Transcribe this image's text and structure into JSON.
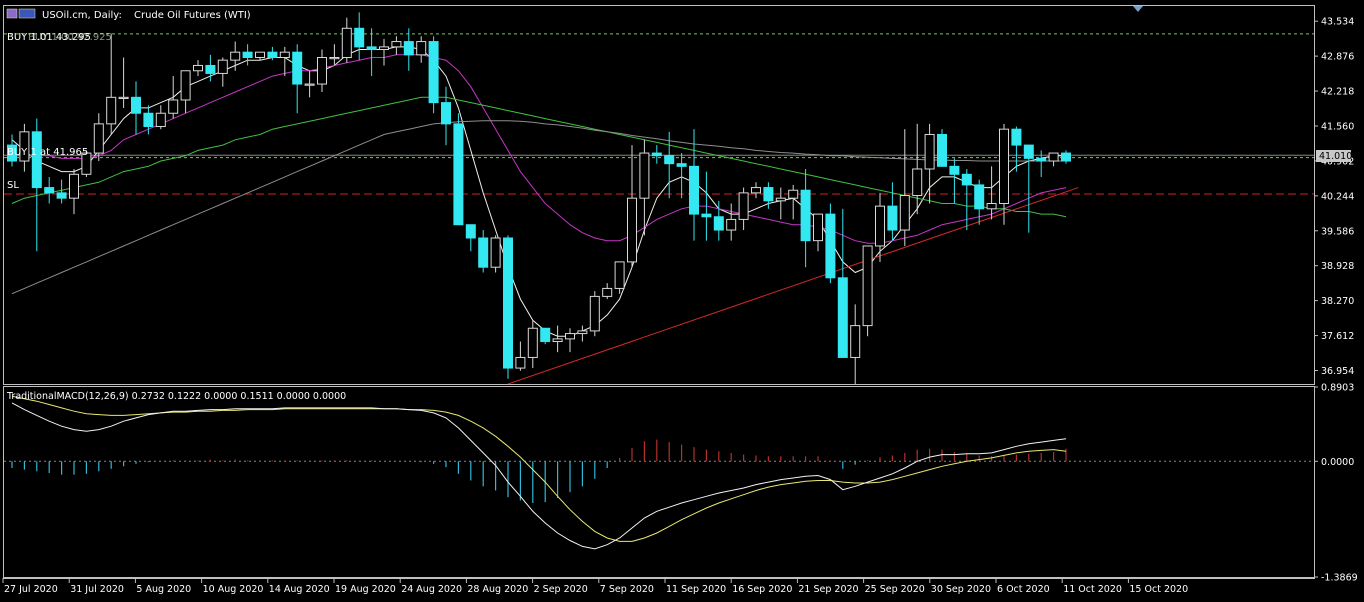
{
  "header": {
    "symbol_label": "USOil.cm, Daily:",
    "instrument_name": "Crude Oil Futures (WTI)"
  },
  "trade_lines": {
    "buy_top": "BUY 1.01 43.295",
    "buy_top_overlap": "BUY 1.00 42.925",
    "buy_mid": "BUY 1 at 41.965",
    "sl": "SL"
  },
  "colors": {
    "background": "#000000",
    "axis": "#c0c0c0",
    "text": "#ffffff",
    "bull": "#000000",
    "bull_border": "#2a2a2a",
    "bear": "#33e8f0",
    "buy_line": "#6fcf4a",
    "sl_line": "#d0222a",
    "price_tag_bg": "#c8c8c8",
    "ma_white": "#f2f2e8",
    "ma_magenta": "#c735c7",
    "ma_green": "#3fc23f",
    "ma_gray": "#8e8e8e",
    "trend_red": "#d12a2a",
    "macd_line": "#e8e870",
    "signal_line": "#f2f2f2",
    "hist_pos": "#b5302a",
    "hist_neg": "#2fb8d8"
  },
  "chart_data": [
    {
      "type": "candlestick",
      "y_ticks": [
        "43.534",
        "42.876",
        "42.218",
        "41.560",
        "40.902",
        "40.244",
        "39.586",
        "38.928",
        "38.270",
        "37.612",
        "36.954"
      ],
      "ylim": [
        36.7,
        43.82
      ],
      "current_price": "41.010",
      "levels": {
        "buy_top": 43.295,
        "buy_mid": 40.965,
        "sl": 40.28
      },
      "x_labels": [
        "27 Jul 2020",
        "31 Jul 2020",
        "5 Aug 2020",
        "10 Aug 2020",
        "14 Aug 2020",
        "19 Aug 2020",
        "24 Aug 2020",
        "28 Aug 2020",
        "2 Sep 2020",
        "7 Sep 2020",
        "11 Sep 2020",
        "16 Sep 2020",
        "21 Sep 2020",
        "25 Sep 2020",
        "30 Sep 2020",
        "6 Oct 2020",
        "11 Oct 2020",
        "15 Oct 2020"
      ],
      "ohlc": [
        [
          41.2,
          41.4,
          40.8,
          40.9
        ],
        [
          40.9,
          41.6,
          40.7,
          41.45
        ],
        [
          41.45,
          41.7,
          39.2,
          40.4
        ],
        [
          40.4,
          40.6,
          40.1,
          40.3
        ],
        [
          40.3,
          40.55,
          40.1,
          40.2
        ],
        [
          40.2,
          40.75,
          39.9,
          40.65
        ],
        [
          40.65,
          41.1,
          40.6,
          41.05
        ],
        [
          41.05,
          41.8,
          40.9,
          41.6
        ],
        [
          41.6,
          43.3,
          41.4,
          42.1
        ],
        [
          42.1,
          42.85,
          41.9,
          42.1
        ],
        [
          42.1,
          42.4,
          41.4,
          41.8
        ],
        [
          41.8,
          41.95,
          41.4,
          41.55
        ],
        [
          41.55,
          41.95,
          41.5,
          41.8
        ],
        [
          41.8,
          42.5,
          41.7,
          42.05
        ],
        [
          42.05,
          42.6,
          41.8,
          42.6
        ],
        [
          42.6,
          42.8,
          42.5,
          42.7
        ],
        [
          42.7,
          42.9,
          42.4,
          42.55
        ],
        [
          42.55,
          42.85,
          42.3,
          42.8
        ],
        [
          42.8,
          43.15,
          42.6,
          42.95
        ],
        [
          42.95,
          43.1,
          42.7,
          42.85
        ],
        [
          42.85,
          42.95,
          42.8,
          42.95
        ],
        [
          42.95,
          43.05,
          42.8,
          42.85
        ],
        [
          42.85,
          43.05,
          42.5,
          42.95
        ],
        [
          42.95,
          43.1,
          41.8,
          42.35
        ],
        [
          42.35,
          42.6,
          42.1,
          42.35
        ],
        [
          42.35,
          43.0,
          42.2,
          42.85
        ],
        [
          42.85,
          43.1,
          42.7,
          42.85
        ],
        [
          42.85,
          43.6,
          42.75,
          43.4
        ],
        [
          43.4,
          43.7,
          42.8,
          43.05
        ],
        [
          43.05,
          43.4,
          42.5,
          43.0
        ],
        [
          43.0,
          43.2,
          42.7,
          43.05
        ],
        [
          43.05,
          43.25,
          42.9,
          43.15
        ],
        [
          43.15,
          43.4,
          42.6,
          42.9
        ],
        [
          42.9,
          43.25,
          42.75,
          43.15
        ],
        [
          43.15,
          43.25,
          41.8,
          42.0
        ],
        [
          42.0,
          42.3,
          41.2,
          41.6
        ],
        [
          41.6,
          41.8,
          39.8,
          39.7
        ],
        [
          39.7,
          39.6,
          39.2,
          39.45
        ],
        [
          39.45,
          39.6,
          38.8,
          38.9
        ],
        [
          38.9,
          39.5,
          38.8,
          39.45
        ],
        [
          39.45,
          39.5,
          36.8,
          37.0
        ],
        [
          37.0,
          37.5,
          36.95,
          37.2
        ],
        [
          37.2,
          37.9,
          37.0,
          37.75
        ],
        [
          37.75,
          37.6,
          37.45,
          37.5
        ],
        [
          37.5,
          37.8,
          37.3,
          37.55
        ],
        [
          37.55,
          37.75,
          37.3,
          37.65
        ],
        [
          37.65,
          37.8,
          37.5,
          37.7
        ],
        [
          37.7,
          38.45,
          37.6,
          38.35
        ],
        [
          38.35,
          38.6,
          38.3,
          38.5
        ],
        [
          38.5,
          39.0,
          38.4,
          39.0
        ],
        [
          39.0,
          41.2,
          38.9,
          40.2
        ],
        [
          40.2,
          41.3,
          39.5,
          41.05
        ],
        [
          41.05,
          41.2,
          40.85,
          41.0
        ],
        [
          41.0,
          41.45,
          40.2,
          40.85
        ],
        [
          40.85,
          41.05,
          40.2,
          40.8
        ],
        [
          40.8,
          41.5,
          39.4,
          39.9
        ],
        [
          39.9,
          40.7,
          39.4,
          39.85
        ],
        [
          39.85,
          40.15,
          39.4,
          39.6
        ],
        [
          39.6,
          40.1,
          39.4,
          39.8
        ],
        [
          39.8,
          40.4,
          39.6,
          40.3
        ],
        [
          40.3,
          40.5,
          40.2,
          40.4
        ],
        [
          40.4,
          40.5,
          40.0,
          40.15
        ],
        [
          40.15,
          40.4,
          39.8,
          40.2
        ],
        [
          40.2,
          40.45,
          39.8,
          40.35
        ],
        [
          40.35,
          40.75,
          38.9,
          39.4
        ],
        [
          39.4,
          39.9,
          39.2,
          39.9
        ],
        [
          39.9,
          40.1,
          38.6,
          38.7
        ],
        [
          38.7,
          40.0,
          37.8,
          37.2
        ],
        [
          37.2,
          38.2,
          36.7,
          37.8
        ],
        [
          37.8,
          39.1,
          37.6,
          39.3
        ],
        [
          39.3,
          40.3,
          39.0,
          40.05
        ],
        [
          40.05,
          40.5,
          39.4,
          39.6
        ],
        [
          39.6,
          41.5,
          39.3,
          40.25
        ],
        [
          40.25,
          41.6,
          39.9,
          40.75
        ],
        [
          40.75,
          41.6,
          40.1,
          41.4
        ],
        [
          41.4,
          41.5,
          40.8,
          40.8
        ],
        [
          40.8,
          40.95,
          40.1,
          40.65
        ],
        [
          40.65,
          40.75,
          39.6,
          40.45
        ],
        [
          40.45,
          40.55,
          39.7,
          40.0
        ],
        [
          40.0,
          40.8,
          39.8,
          40.1
        ],
        [
          40.1,
          41.6,
          39.7,
          41.5
        ],
        [
          41.5,
          41.55,
          40.7,
          41.2
        ],
        [
          41.2,
          41.2,
          39.55,
          40.95
        ],
        [
          40.95,
          41.1,
          40.6,
          40.9
        ],
        [
          40.9,
          41.05,
          40.8,
          41.05
        ],
        [
          41.05,
          41.1,
          40.85,
          40.9
        ]
      ],
      "series": [
        {
          "name": "",
          "color_key": "ma_white",
          "values": [
            41.3,
            41.1,
            40.9,
            40.8,
            40.7,
            40.7,
            40.8,
            41.1,
            41.4,
            41.7,
            41.9,
            41.9,
            42.0,
            42.1,
            42.3,
            42.4,
            42.5,
            42.6,
            42.7,
            42.8,
            42.8,
            42.85,
            42.85,
            42.7,
            42.6,
            42.6,
            42.7,
            42.9,
            43.0,
            43.0,
            43.0,
            43.05,
            43.05,
            43.0,
            42.8,
            42.5,
            41.9,
            41.1,
            40.3,
            39.6,
            38.9,
            38.3,
            37.9,
            37.7,
            37.6,
            37.6,
            37.7,
            37.8,
            38.0,
            38.3,
            38.9,
            39.6,
            40.2,
            40.5,
            40.6,
            40.5,
            40.3,
            40.0,
            39.9,
            39.9,
            40.0,
            40.1,
            40.15,
            40.2,
            40.0,
            39.8,
            39.4,
            39.0,
            38.8,
            38.9,
            39.2,
            39.4,
            39.7,
            40.0,
            40.4,
            40.6,
            40.6,
            40.5,
            40.4,
            40.4,
            40.6,
            40.8,
            40.9,
            40.95,
            41.0,
            41.0
          ]
        },
        {
          "name": "",
          "color_key": "ma_magenta",
          "values": [
            41.0,
            41.0,
            41.0,
            41.0,
            40.95,
            40.95,
            40.95,
            41.0,
            41.1,
            41.3,
            41.4,
            41.5,
            41.6,
            41.7,
            41.8,
            41.9,
            42.0,
            42.1,
            42.2,
            42.3,
            42.4,
            42.5,
            42.55,
            42.6,
            42.6,
            42.65,
            42.7,
            42.75,
            42.8,
            42.85,
            42.85,
            42.9,
            42.9,
            42.9,
            42.85,
            42.8,
            42.6,
            42.3,
            41.9,
            41.5,
            41.1,
            40.7,
            40.4,
            40.1,
            39.9,
            39.7,
            39.55,
            39.45,
            39.4,
            39.4,
            39.5,
            39.65,
            39.8,
            39.9,
            40.0,
            40.05,
            40.05,
            40.0,
            39.95,
            39.9,
            39.85,
            39.8,
            39.75,
            39.7,
            39.7,
            39.65,
            39.6,
            39.5,
            39.4,
            39.35,
            39.35,
            39.4,
            39.45,
            39.5,
            39.6,
            39.7,
            39.75,
            39.8,
            39.85,
            39.9,
            40.0,
            40.1,
            40.2,
            40.3,
            40.35,
            40.4
          ]
        },
        {
          "name": "",
          "color_key": "ma_green",
          "values": [
            40.1,
            40.2,
            40.25,
            40.3,
            40.35,
            40.4,
            40.45,
            40.5,
            40.6,
            40.7,
            40.75,
            40.8,
            40.9,
            40.95,
            41.0,
            41.1,
            41.15,
            41.2,
            41.3,
            41.35,
            41.4,
            41.5,
            41.55,
            41.6,
            41.65,
            41.7,
            41.75,
            41.8,
            41.85,
            41.9,
            41.95,
            42.0,
            42.05,
            42.1,
            42.1,
            42.1,
            42.05,
            42.0,
            41.95,
            41.9,
            41.85,
            41.8,
            41.75,
            41.7,
            41.65,
            41.6,
            41.55,
            41.5,
            41.45,
            41.4,
            41.35,
            41.3,
            41.25,
            41.2,
            41.15,
            41.1,
            41.05,
            41.0,
            40.95,
            40.9,
            40.85,
            40.8,
            40.75,
            40.7,
            40.65,
            40.6,
            40.55,
            40.5,
            40.45,
            40.4,
            40.35,
            40.3,
            40.25,
            40.2,
            40.15,
            40.1,
            40.1,
            40.05,
            40.05,
            40.0,
            40.0,
            39.95,
            39.95,
            39.9,
            39.9,
            39.85
          ]
        },
        {
          "name": "",
          "color_key": "ma_gray",
          "values": [
            38.4,
            38.5,
            38.6,
            38.7,
            38.8,
            38.9,
            39.0,
            39.1,
            39.2,
            39.3,
            39.4,
            39.5,
            39.6,
            39.7,
            39.8,
            39.9,
            40.0,
            40.1,
            40.2,
            40.3,
            40.4,
            40.5,
            40.6,
            40.7,
            40.8,
            40.9,
            41.0,
            41.1,
            41.2,
            41.3,
            41.4,
            41.45,
            41.5,
            41.55,
            41.6,
            41.62,
            41.64,
            41.65,
            41.66,
            41.66,
            41.66,
            41.65,
            41.63,
            41.6,
            41.58,
            41.55,
            41.52,
            41.48,
            41.45,
            41.42,
            41.38,
            41.35,
            41.32,
            41.28,
            41.25,
            41.22,
            41.2,
            41.18,
            41.15,
            41.13,
            41.1,
            41.08,
            41.06,
            41.05,
            41.03,
            41.02,
            41.0,
            41.0,
            40.98,
            40.97,
            40.96,
            40.95,
            40.94,
            40.93,
            40.92,
            40.92,
            40.91,
            40.91,
            40.9,
            40.9,
            40.9,
            40.9,
            40.9,
            40.9,
            40.9,
            40.9
          ]
        }
      ],
      "trendline": {
        "from": [
          40,
          36.7
        ],
        "to": [
          86,
          40.4
        ]
      }
    },
    {
      "type": "macd",
      "label": "TraditionalMACD(12,26,9) 0.2732 0.1222 0.0000 0.1511 0.0000 0.0000",
      "y_ticks": [
        "0.8903",
        "0.0000",
        "-1.3869"
      ],
      "ylim": [
        -1.3869,
        0.8903
      ],
      "macd": [
        0.7,
        0.62,
        0.55,
        0.48,
        0.42,
        0.38,
        0.36,
        0.38,
        0.42,
        0.48,
        0.52,
        0.56,
        0.58,
        0.6,
        0.6,
        0.61,
        0.62,
        0.62,
        0.63,
        0.63,
        0.63,
        0.63,
        0.64,
        0.64,
        0.64,
        0.64,
        0.64,
        0.64,
        0.64,
        0.64,
        0.63,
        0.63,
        0.62,
        0.61,
        0.58,
        0.52,
        0.4,
        0.25,
        0.1,
        -0.05,
        -0.25,
        -0.42,
        -0.6,
        -0.74,
        -0.86,
        -0.95,
        -1.02,
        -1.05,
        -1.0,
        -0.92,
        -0.8,
        -0.68,
        -0.6,
        -0.55,
        -0.5,
        -0.46,
        -0.42,
        -0.38,
        -0.35,
        -0.32,
        -0.28,
        -0.25,
        -0.22,
        -0.2,
        -0.18,
        -0.17,
        -0.22,
        -0.34,
        -0.3,
        -0.25,
        -0.2,
        -0.15,
        -0.08,
        0.0,
        0.05,
        0.08,
        0.08,
        0.09,
        0.09,
        0.1,
        0.14,
        0.18,
        0.21,
        0.23,
        0.25,
        0.27
      ],
      "signal": [
        0.78,
        0.75,
        0.72,
        0.68,
        0.64,
        0.6,
        0.57,
        0.56,
        0.55,
        0.55,
        0.56,
        0.57,
        0.58,
        0.59,
        0.59,
        0.6,
        0.6,
        0.61,
        0.61,
        0.62,
        0.62,
        0.62,
        0.63,
        0.63,
        0.63,
        0.63,
        0.63,
        0.63,
        0.63,
        0.63,
        0.63,
        0.63,
        0.62,
        0.62,
        0.61,
        0.59,
        0.55,
        0.48,
        0.4,
        0.3,
        0.18,
        0.05,
        -0.1,
        -0.25,
        -0.42,
        -0.58,
        -0.72,
        -0.84,
        -0.92,
        -0.96,
        -0.96,
        -0.92,
        -0.86,
        -0.78,
        -0.7,
        -0.63,
        -0.56,
        -0.5,
        -0.45,
        -0.4,
        -0.35,
        -0.31,
        -0.28,
        -0.26,
        -0.24,
        -0.23,
        -0.23,
        -0.25,
        -0.26,
        -0.26,
        -0.25,
        -0.22,
        -0.18,
        -0.14,
        -0.1,
        -0.06,
        -0.03,
        0.0,
        0.02,
        0.04,
        0.07,
        0.1,
        0.12,
        0.13,
        0.14,
        0.12
      ],
      "histogram": [
        -0.08,
        -0.1,
        -0.12,
        -0.14,
        -0.16,
        -0.16,
        -0.15,
        -0.12,
        -0.09,
        -0.06,
        -0.03,
        -0.01,
        0.0,
        0.01,
        0.01,
        0.01,
        0.02,
        0.01,
        0.02,
        0.01,
        0.01,
        0.01,
        0.01,
        0.01,
        0.01,
        0.01,
        0.01,
        0.01,
        0.01,
        0.01,
        0.0,
        0.0,
        0.0,
        -0.01,
        -0.03,
        -0.07,
        -0.15,
        -0.23,
        -0.3,
        -0.35,
        -0.43,
        -0.47,
        -0.5,
        -0.49,
        -0.44,
        -0.37,
        -0.3,
        -0.21,
        -0.08,
        0.04,
        0.16,
        0.24,
        0.26,
        0.23,
        0.2,
        0.17,
        0.14,
        0.12,
        0.1,
        0.08,
        0.07,
        0.06,
        0.06,
        0.06,
        0.06,
        0.06,
        0.01,
        -0.09,
        -0.04,
        0.01,
        0.05,
        0.07,
        0.1,
        0.14,
        0.15,
        0.14,
        0.11,
        0.09,
        0.07,
        0.06,
        0.07,
        0.08,
        0.09,
        0.1,
        0.11,
        0.15
      ]
    }
  ]
}
